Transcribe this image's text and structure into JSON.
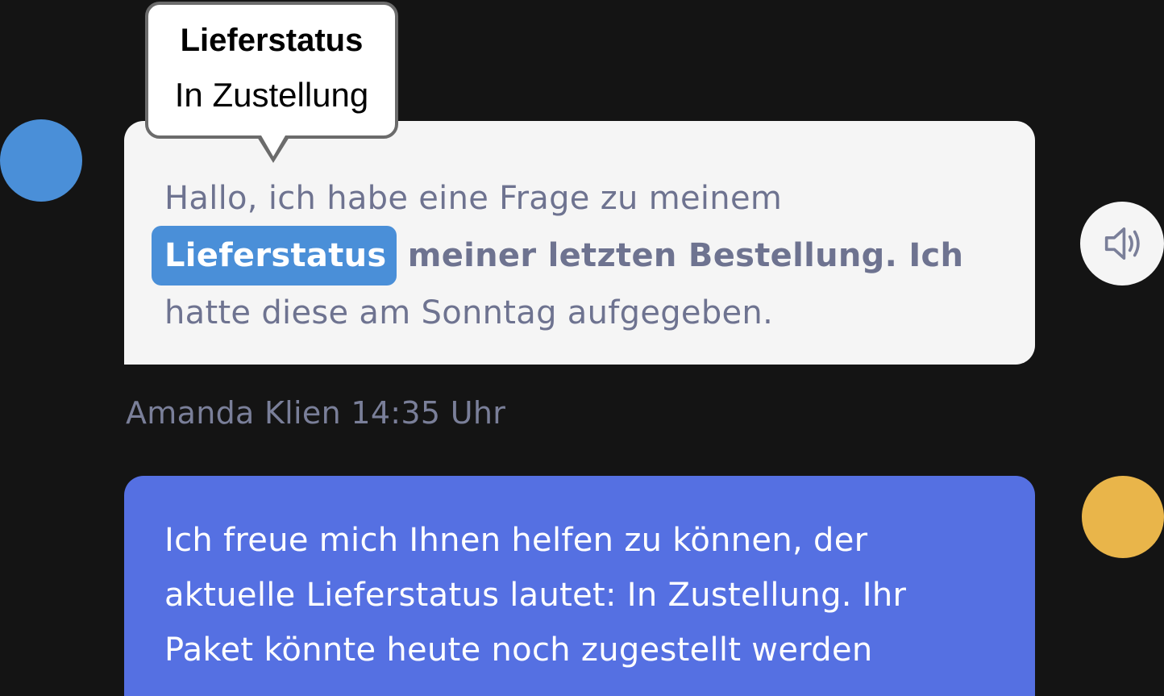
{
  "tooltip": {
    "title": "Lieferstatus",
    "value": "In Zustellung"
  },
  "user_message": {
    "line1": "Hallo, ich habe eine Frage zu meinem",
    "highlight": "Lieferstatus",
    "line2_rest": " meiner letzten Bestellung. Ich",
    "line3": "hatte diese am Sonntag aufgegeben."
  },
  "meta": {
    "author_time": "Amanda Klien 14:35 Uhr"
  },
  "bot_message": {
    "line1": "Ich freue mich Ihnen helfen zu können, der",
    "line2": "aktuelle Lieferstatus lautet: In Zustellung. Ihr",
    "line3": "Paket könnte heute noch zugestellt werden"
  },
  "icons": {
    "speaker": "speaker-icon"
  },
  "colors": {
    "background": "#141414",
    "user_avatar": "#4a8fd8",
    "bot_avatar": "#e9b54a",
    "user_bubble": "#f5f5f5",
    "bot_bubble": "#5570e2",
    "highlight": "#4a8fd8"
  }
}
